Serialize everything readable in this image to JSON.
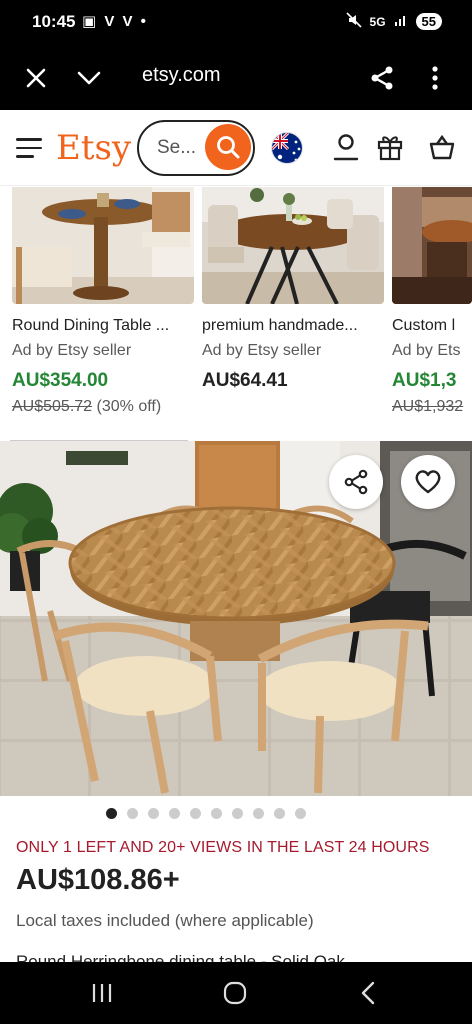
{
  "status_bar": {
    "time": "10:45",
    "left_icons": "▣ V V •",
    "network": "5G",
    "battery": "55"
  },
  "browser": {
    "url": "etsy.com"
  },
  "header": {
    "logo": "Etsy",
    "search_placeholder": "Se..."
  },
  "ads": [
    {
      "title": "Round Dining Table ...",
      "seller": "Ad by Etsy seller",
      "price": "AU$354.00",
      "original_price": "AU$505.72",
      "discount": "(30% off)"
    },
    {
      "title": "premium handmade...",
      "seller": "Ad by Etsy seller",
      "price": "AU$64.41"
    },
    {
      "title": "Custom l",
      "seller": "Ad by Ets",
      "price": "AU$1,3",
      "original_price": "AU$1,932"
    }
  ],
  "listing": {
    "dots_total": 10,
    "dots_active": 0,
    "scarcity": "ONLY 1 LEFT AND 20+ VIEWS IN THE LAST 24 HOURS",
    "price": "AU$108.86+",
    "tax_note": "Local taxes included (where applicable)",
    "title": "Round Herringbone dining table - Solid Oak"
  },
  "colors": {
    "brand": "#F1641E",
    "sale_price": "#258635",
    "scarcity": "#A61A2E"
  }
}
